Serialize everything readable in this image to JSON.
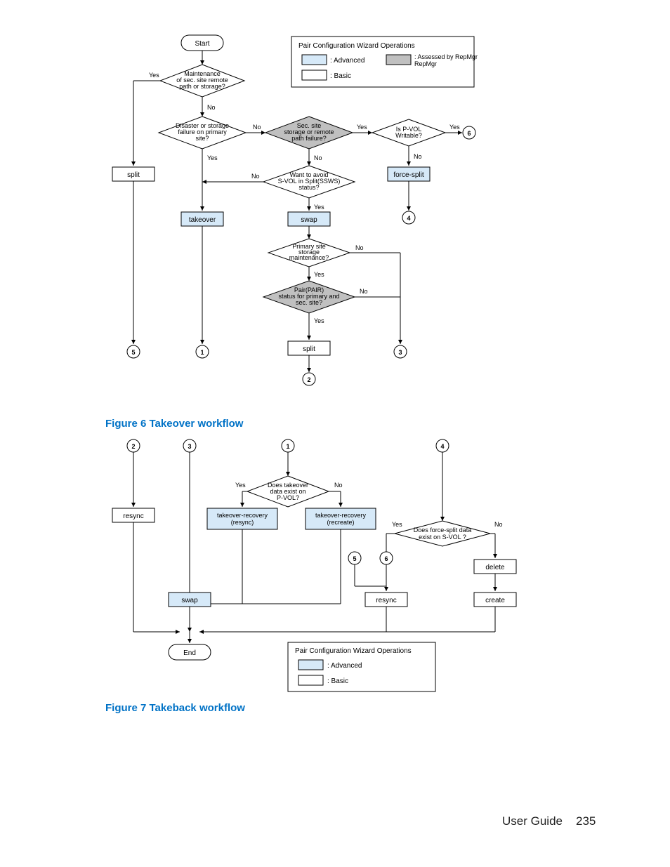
{
  "captions": {
    "fig6": "Figure 6 Takeover workflow",
    "fig7": "Figure 7 Takeback workflow"
  },
  "footer": {
    "guide": "User Guide",
    "page": "235"
  },
  "legend": {
    "title": "Pair Configuration Wizard Operations",
    "advanced": ": Advanced",
    "assessed": ": Assessed by RepMgr",
    "basic": ": Basic"
  },
  "flow1": {
    "start": "Start",
    "d_maint": "Maintenance\nof sec. site remote\npath or storage?",
    "d_disaster": "Disaster or storage\nfailure on primary\nsite?",
    "d_secsite": "Sec. site\nstorage or remote\npath failure?",
    "d_pvol": "Is P-VOL\nWritable?",
    "d_avoid": "Want to avoid\nS-VOL in Split(SSWS)\nstatus?",
    "d_primmaint": "Primary site\nstorage\nmaintenance?",
    "d_pair": "Pair(PAIR)\nstatus for primary and\nsec. site?",
    "b_split": "split",
    "b_takeover": "takeover",
    "b_swap": "swap",
    "b_forcesplit": "force-split",
    "b_split2": "split",
    "yes": "Yes",
    "no": "No",
    "c1": "1",
    "c2": "2",
    "c3": "3",
    "c4": "4",
    "c5": "5",
    "c6": "6"
  },
  "flow2": {
    "c1": "1",
    "c2": "2",
    "c3": "3",
    "c4": "4",
    "c5": "5",
    "c6": "6",
    "d_takeover": "Does takeover\ndata exist on\nP-VOL?",
    "d_forcesplit": "Does force-split data\nexist on S-VOL ?",
    "b_resync": "resync",
    "b_trec_resync": "takeover-recovery\n(resync)",
    "b_trec_recreate": "takeover-recovery\n(recreate)",
    "b_delete": "delete",
    "b_swap": "swap",
    "b_resync2": "resync",
    "b_create": "create",
    "end": "End",
    "yes": "Yes",
    "no": "No"
  },
  "legend2": {
    "title": "Pair Configuration Wizard Operations",
    "advanced": ": Advanced",
    "basic": ": Basic"
  }
}
